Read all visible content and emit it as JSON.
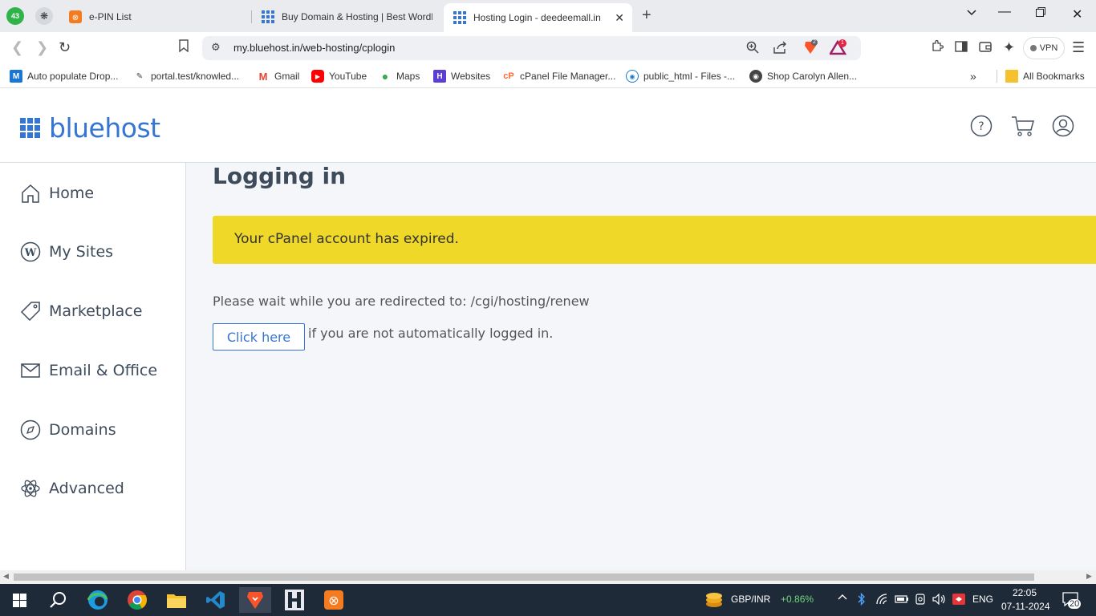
{
  "browser": {
    "tabs": [
      {
        "title": "e-PIN List",
        "active": false
      },
      {
        "title": "Buy Domain & Hosting | Best WordPress",
        "active": false
      },
      {
        "title": "Hosting Login - deedeemall.in",
        "active": true
      }
    ],
    "ext_badge": "43",
    "url": "my.bluehost.in/web-hosting/cplogin",
    "brave_badge": "2",
    "alert_badge": "1",
    "vpn_label": "VPN",
    "bookmarks": [
      {
        "label": "Auto populate Drop..."
      },
      {
        "label": "portal.test/knowled..."
      },
      {
        "label": "Gmail"
      },
      {
        "label": "YouTube"
      },
      {
        "label": "Maps"
      },
      {
        "label": "Websites"
      },
      {
        "label": "cPanel File Manager..."
      },
      {
        "label": "public_html - Files -..."
      },
      {
        "label": "Shop Carolyn Allen..."
      }
    ],
    "all_bookmarks": "All Bookmarks"
  },
  "site": {
    "logo": "bluehost",
    "brand_color": "#3575d3",
    "nav": [
      {
        "label": "Home",
        "icon": "home-icon"
      },
      {
        "label": "My Sites",
        "icon": "wordpress-icon"
      },
      {
        "label": "Marketplace",
        "icon": "tag-icon"
      },
      {
        "label": "Email & Office",
        "icon": "mail-icon"
      },
      {
        "label": "Domains",
        "icon": "compass-icon"
      },
      {
        "label": "Advanced",
        "icon": "atom-icon"
      }
    ],
    "page_title": "Logging in",
    "alert": "Your cPanel account has expired.",
    "alert_color": "#f0d829",
    "redirect_text": "Please wait while you are redirected to: /cgi/hosting/renew",
    "button_label": "Click here",
    "button_suffix": "if you are not automatically logged in."
  },
  "taskbar": {
    "ticker": "GBP/INR",
    "ticker_change": "+0.86%",
    "lang": "ENG",
    "time": "22:05",
    "date": "07-11-2024",
    "notifications": "20"
  }
}
